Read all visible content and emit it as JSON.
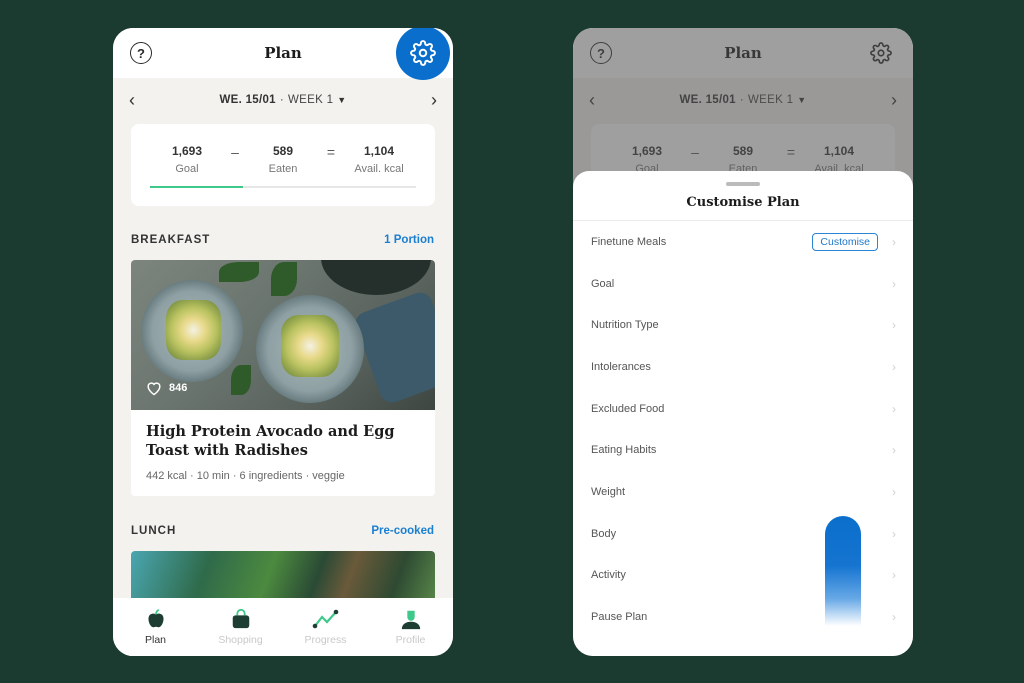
{
  "left_screen": {
    "header": {
      "title": "Plan",
      "help_icon": "question-circle-icon",
      "settings_icon": "gear-icon"
    },
    "date_nav": {
      "date": "WE. 15/01",
      "separator": "·",
      "week": "WEEK 1",
      "prev_icon": "chevron-left-icon",
      "next_icon": "chevron-right-icon",
      "dropdown_icon": "caret-down-icon"
    },
    "kcal_summary": {
      "goal": {
        "value": "1,693",
        "label": "Goal"
      },
      "minus": "–",
      "eaten": {
        "value": "589",
        "label": "Eaten"
      },
      "equals": "=",
      "available": {
        "value": "1,104",
        "label": "Avail. kcal"
      },
      "progress_fraction": 0.35,
      "progress_color": "#3ec88a"
    },
    "meals": [
      {
        "section": "BREAKFAST",
        "action": "1 Portion",
        "recipe": {
          "likes": "846",
          "title": "High Protein Avocado and Egg Toast with Radishes",
          "meta": "442 kcal · 10 min · 6 ingredients · veggie"
        }
      },
      {
        "section": "LUNCH",
        "action": "Pre-cooked"
      }
    ],
    "tabbar": [
      {
        "label": "Plan",
        "icon": "apple-icon",
        "active": true
      },
      {
        "label": "Shopping",
        "icon": "shopping-bag-icon",
        "active": false
      },
      {
        "label": "Progress",
        "icon": "progress-chart-icon",
        "active": false
      },
      {
        "label": "Profile",
        "icon": "profile-icon",
        "active": false
      }
    ]
  },
  "right_screen": {
    "header": {
      "title": "Plan"
    },
    "date_nav": {
      "date": "WE. 15/01",
      "separator": "·",
      "week": "WEEK 1"
    },
    "kcal_summary": {
      "goal": {
        "value": "1,693",
        "label": "Goal"
      },
      "minus": "–",
      "eaten": {
        "value": "589",
        "label": "Eaten"
      },
      "equals": "=",
      "available": {
        "value": "1,104",
        "label": "Avail. kcal"
      }
    },
    "sheet": {
      "title": "Customise Plan",
      "options": [
        {
          "label": "Finetune Meals",
          "button": "Customise"
        },
        {
          "label": "Goal"
        },
        {
          "label": "Nutrition Type"
        },
        {
          "label": "Intolerances"
        },
        {
          "label": "Excluded Food"
        },
        {
          "label": "Eating Habits"
        },
        {
          "label": "Weight"
        },
        {
          "label": "Body"
        },
        {
          "label": "Activity"
        },
        {
          "label": "Pause Plan"
        }
      ]
    }
  },
  "colors": {
    "background": "#1b3a30",
    "accent_blue": "#0a6fcc",
    "link_blue": "#1b7fd0",
    "progress_green": "#3ec88a",
    "brand_dark": "#1e3d33"
  }
}
